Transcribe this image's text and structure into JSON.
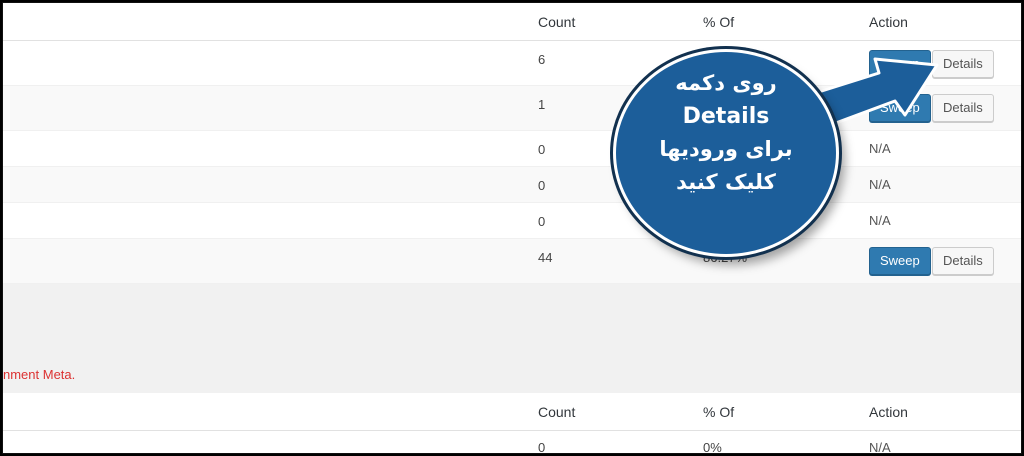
{
  "headers": {
    "count": "Count",
    "pct": "% Of",
    "action": "Action"
  },
  "rows": [
    {
      "count": "6",
      "pct": "",
      "action": "buttons"
    },
    {
      "count": "1",
      "pct": "",
      "action": "buttons"
    },
    {
      "count": "0",
      "pct": "",
      "action": "N/A"
    },
    {
      "count": "0",
      "pct": "",
      "action": "N/A"
    },
    {
      "count": "0",
      "pct": "",
      "action": "N/A"
    },
    {
      "count": "44",
      "pct": "86.27%",
      "action": "buttons"
    }
  ],
  "buttons": {
    "sweep": "Sweep",
    "details": "Details",
    "na": "N/A"
  },
  "note": "nment Meta.",
  "table2": {
    "row1": {
      "count": "0",
      "pct": "0%",
      "action": "N/A"
    }
  },
  "callout": {
    "line1": "روی دکمه",
    "line2": "Details",
    "line3": "برای ورودیها",
    "line4": "کلیک کنید",
    "color": "#1c5e9a"
  }
}
